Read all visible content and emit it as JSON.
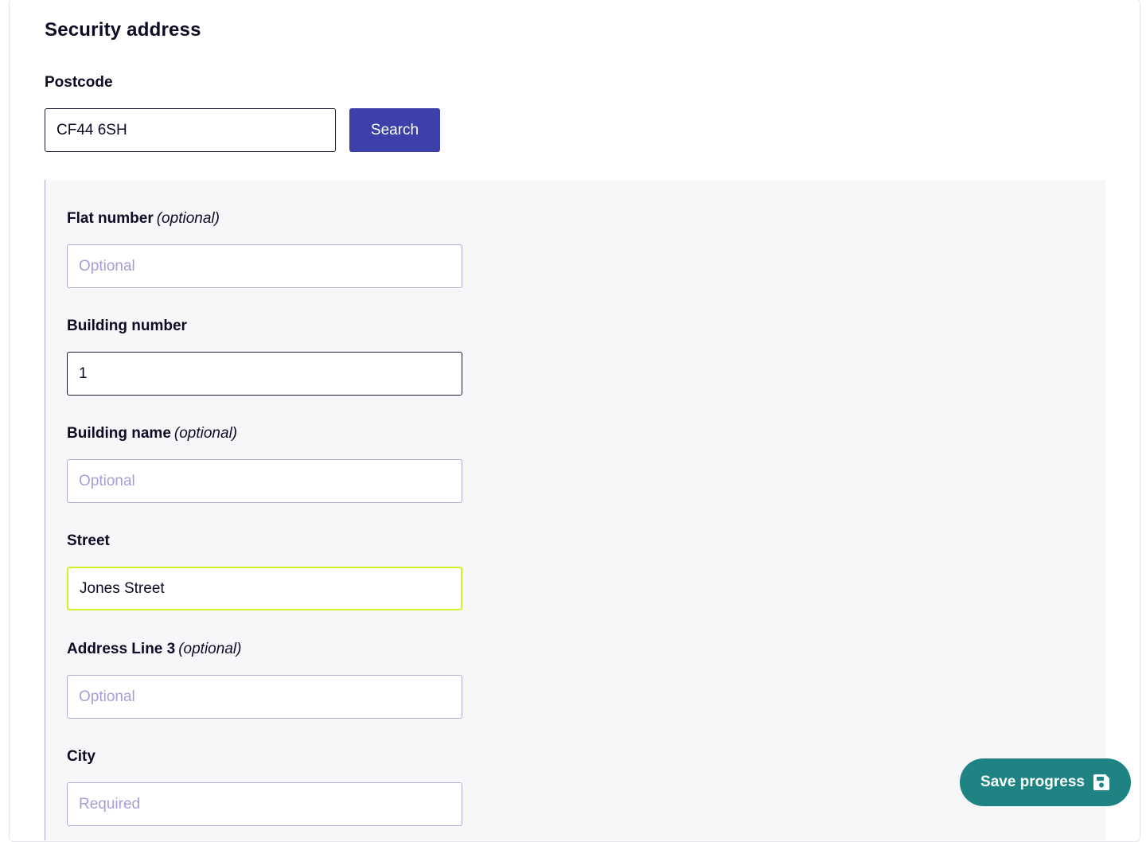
{
  "section": {
    "title": "Security address"
  },
  "postcode": {
    "label": "Postcode",
    "value": "CF44 6SH",
    "search_label": "Search"
  },
  "fields": {
    "flat_number": {
      "label": "Flat number",
      "optional": "(optional)",
      "value": "",
      "placeholder": "Optional"
    },
    "building_number": {
      "label": "Building number",
      "value": "1",
      "placeholder": ""
    },
    "building_name": {
      "label": "Building name",
      "optional": "(optional)",
      "value": "",
      "placeholder": "Optional"
    },
    "street": {
      "label": "Street",
      "value": "Jones Street",
      "placeholder": ""
    },
    "address_line_3": {
      "label": "Address Line 3",
      "optional": "(optional)",
      "value": "",
      "placeholder": "Optional"
    },
    "city": {
      "label": "City",
      "value": "",
      "placeholder": "Required"
    }
  },
  "save_progress": {
    "label": "Save progress",
    "icon": "floppy-disk-icon"
  },
  "colors": {
    "primary_button": "#3c40a8",
    "save_button": "#1f8383",
    "focus_border": "#d4ef2c",
    "placeholder": "#a59fd6",
    "panel_background": "#f7f7fa"
  }
}
